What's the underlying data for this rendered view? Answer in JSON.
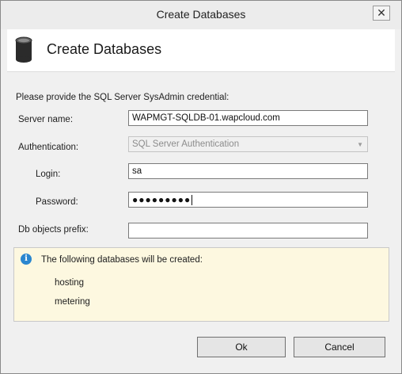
{
  "window": {
    "title": "Create Databases",
    "close_glyph": "✕"
  },
  "header": {
    "icon": "database-icon",
    "title": "Create Databases"
  },
  "form": {
    "instruction": "Please provide the SQL Server SysAdmin credential:",
    "server_name_label": "Server name:",
    "server_name_value": "WAPMGT-SQLDB-01.wapcloud.com",
    "authentication_label": "Authentication:",
    "authentication_value": "SQL Server Authentication",
    "login_label": "Login:",
    "login_value": "sa",
    "password_label": "Password:",
    "password_value": "●●●●●●●●●",
    "prefix_label": "Db objects prefix:",
    "prefix_value": ""
  },
  "info": {
    "icon": "info-icon",
    "message": "The following databases will be created:",
    "databases": [
      "hosting",
      "metering"
    ]
  },
  "buttons": {
    "ok": "Ok",
    "cancel": "Cancel"
  },
  "colors": {
    "info_background": "#fdf8e0",
    "info_icon": "#2a86cf"
  }
}
